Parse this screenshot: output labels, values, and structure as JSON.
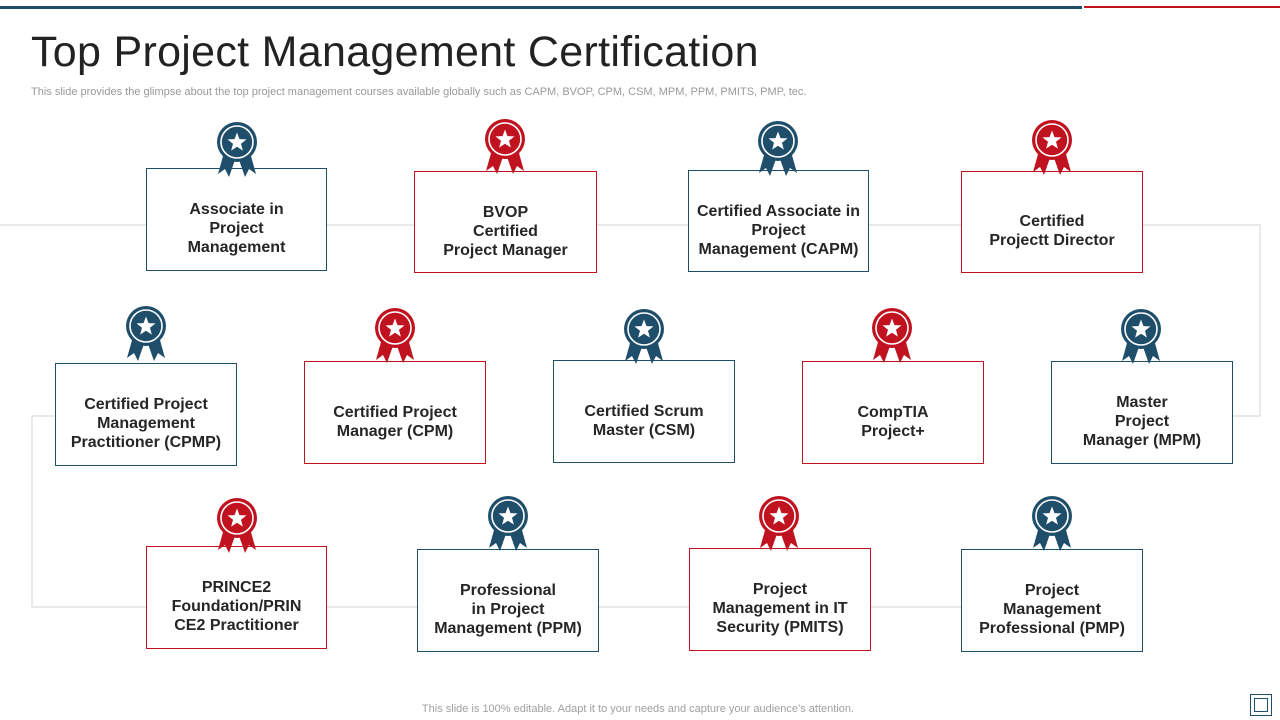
{
  "header": {
    "title": "Top Project Management Certification",
    "subtitle": "This slide provides the glimpse about the top project management courses available globally such as CAPM, BVOP,  CPM,  CSM,  MPM,  PPM,  PMITS,  PMP,  tec."
  },
  "footer": {
    "note": "This slide is 100% editable. Adapt it to your needs and capture your audience’s attention."
  },
  "colors": {
    "blue": "#1f4e6b",
    "red": "#c0121f"
  },
  "certifications": [
    {
      "label": "Associate  in\nProject\nManagement",
      "color": "blue"
    },
    {
      "label": "BVOP\nCertified\nProject Manager",
      "color": "red"
    },
    {
      "label": "Certified Associate  in\nProject\nManagement (CAPM)",
      "color": "blue"
    },
    {
      "label": "Certified\nProjectt Director",
      "color": "red"
    },
    {
      "label": "Certified Project\nManagement\nPractitioner (CPMP)",
      "color": "blue"
    },
    {
      "label": "Certified Project\nManager (CPM)",
      "color": "red"
    },
    {
      "label": "Certified Scrum\nMaster (CSM)",
      "color": "blue"
    },
    {
      "label": "CompTIA\nProject+",
      "color": "red"
    },
    {
      "label": "Master\nProject\nManager (MPM)",
      "color": "blue"
    },
    {
      "label": "PRINCE2\nFoundation/PRIN\nCE2 Practitioner",
      "color": "red"
    },
    {
      "label": "Professional\nin Project\nManagement (PPM)",
      "color": "blue"
    },
    {
      "label": "Project\nManagement in IT\nSecurity (PMITS)",
      "color": "red"
    },
    {
      "label": "Project\nManagement\nProfessional (PMP)",
      "color": "blue"
    }
  ]
}
